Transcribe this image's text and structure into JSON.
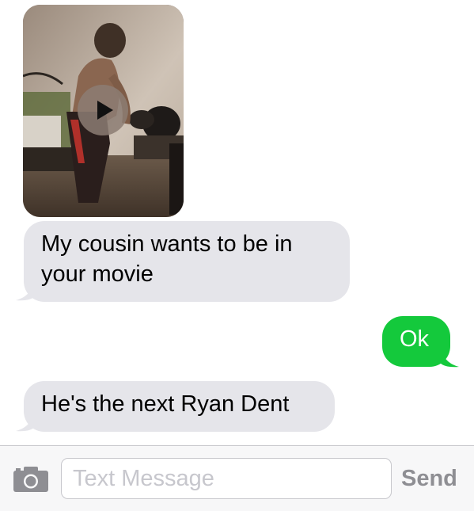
{
  "thread": {
    "video_message": {
      "sender": "incoming",
      "play_icon": "play-icon"
    },
    "messages": [
      {
        "direction": "incoming",
        "text": "My cousin wants to be in\nyour movie"
      },
      {
        "direction": "outgoing",
        "text": "Ok"
      },
      {
        "direction": "incoming",
        "text": "He's the next Ryan Dent"
      }
    ]
  },
  "compose": {
    "camera_icon": "camera-icon",
    "placeholder": "Text Message",
    "send_label": "Send"
  },
  "colors": {
    "incoming_bubble": "#e5e5ea",
    "outgoing_bubble": "#14c93c",
    "send_disabled": "#8e8e93"
  }
}
